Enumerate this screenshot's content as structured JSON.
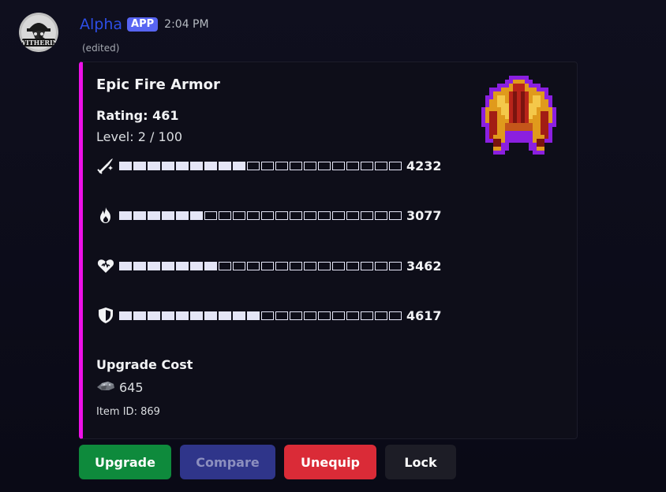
{
  "message": {
    "author": "Alpha",
    "app_badge": "APP",
    "timestamp": "2:04 PM",
    "edited": "(edited)",
    "avatar_text": "WITHERIN"
  },
  "embed": {
    "accent_color": "#ee10e8",
    "title": "Epic Fire Armor",
    "rating": "Rating: 461",
    "level": "Level: 2 / 100",
    "stats": [
      {
        "icon": "sword-sparkle-icon",
        "filled": 9,
        "total": 20,
        "value": "4232"
      },
      {
        "icon": "fire-icon",
        "filled": 6,
        "total": 20,
        "value": "3077"
      },
      {
        "icon": "heart-icon",
        "filled": 7,
        "total": 20,
        "value": "3462"
      },
      {
        "icon": "shield-icon",
        "filled": 10,
        "total": 20,
        "value": "4617"
      }
    ],
    "upgrade_cost_title": "Upgrade Cost",
    "upgrade_cost_icon": "ore-icon",
    "upgrade_cost_value": "645",
    "item_id": "Item ID: 869",
    "thumbnail": "fire-armor-icon"
  },
  "buttons": {
    "upgrade": "Upgrade",
    "compare": "Compare",
    "unequip": "Unequip",
    "lock": "Lock"
  },
  "colors": {
    "author": "#2d4ee8",
    "app_badge": "#5865f2",
    "upgrade": "#0e8a3c",
    "compare": "#2f358a",
    "unequip": "#da2b37",
    "lock": "#1d1d26"
  }
}
